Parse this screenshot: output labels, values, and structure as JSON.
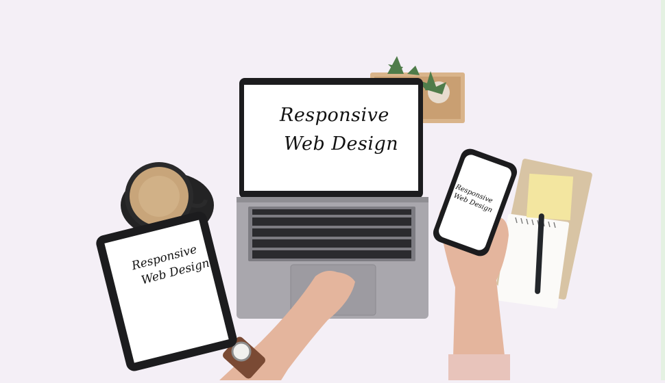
{
  "laptop_screen": {
    "line1": "Responsive",
    "line2": "Web Design"
  },
  "tablet_screen": {
    "line1": "Responsive",
    "line2": "Web Design"
  },
  "phone_screen": {
    "line1": "Responsive",
    "line2": "Web Design"
  },
  "colors": {
    "background": "#f4eff6",
    "laptop_body": "#a9a7ad",
    "device_bezel": "#1c1c1e",
    "coffee": "#c8a57a",
    "sticky_note": "#f3e6a0",
    "notebook": "#d8c4a4"
  }
}
